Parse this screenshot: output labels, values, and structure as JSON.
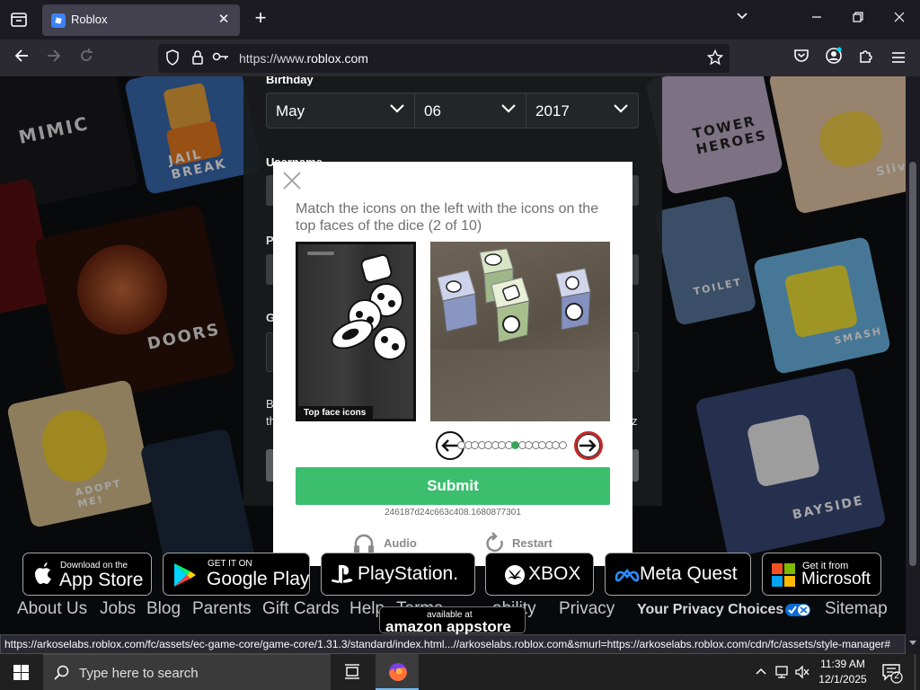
{
  "browser": {
    "tab_title": "Roblox",
    "tab_close": "✕",
    "new_tab": "+",
    "url_prefix": "https://www.",
    "url_domain": "roblox.com",
    "status_url": "https://arkoselabs.roblox.com/fc/assets/ec-game-core/game-core/1.31.3/standard/index.html...//arkoselabs.roblox.com&smurl=https://arkoselabs.roblox.com/cdn/fc/assets/style-manager#",
    "colors": {
      "chrome_bg": "#1c1b22",
      "toolbar_bg": "#2b2a33",
      "tab_active": "#42414d"
    }
  },
  "signup": {
    "birthday_label": "Birthday",
    "month": "May",
    "day": "06",
    "year": "2017",
    "username_label": "Username",
    "password_label": "P",
    "gender_label": "G",
    "terms_fragment_1": "B",
    "terms_fragment_2": "th",
    "terms_fragment_right": "z"
  },
  "background": {
    "labels": [
      "MIMIC",
      "JAIL BREAK",
      "DOORS",
      "TOWER HEROES",
      "TOILET",
      "ADOPT ME!",
      "BAYSIDE",
      "SMASH",
      "Slivi"
    ]
  },
  "captcha": {
    "prompt": "Match the icons on the left with the icons on the top faces of the dice (2 of 10)",
    "left_caption": "Top face icons",
    "submit": "Submit",
    "session_id": "246187d24c663c408.1680877301",
    "audio": "Audio",
    "restart": "Restart",
    "pages_total": 16,
    "current_page_index": 8,
    "accent": "#3cbe6f"
  },
  "footer": {
    "badges": {
      "appstore_small": "Download on the",
      "appstore_big": "App Store",
      "google_small": "GET IT ON",
      "google_big": "Google Play",
      "playstation": "PlayStation.",
      "xbox": "XBOX",
      "meta": "Meta Quest",
      "ms_small": "Get it from",
      "ms_big": "Microsoft",
      "amazon_small": "available at",
      "amazon_big": "amazon appstore"
    },
    "links": {
      "about": "About Us",
      "jobs": "Jobs",
      "blog": "Blog",
      "parents": "Parents",
      "gift_cards": "Gift Cards",
      "help": "Help",
      "terms": "Terms",
      "accessibility": "ability",
      "privacy": "Privacy",
      "privacy_choices": "Your Privacy Choices",
      "sitemap": "Sitemap"
    }
  },
  "taskbar": {
    "search_placeholder": "Type here to search",
    "time": "11:39 AM",
    "date": "12/1/2025",
    "notification_count": "2"
  }
}
